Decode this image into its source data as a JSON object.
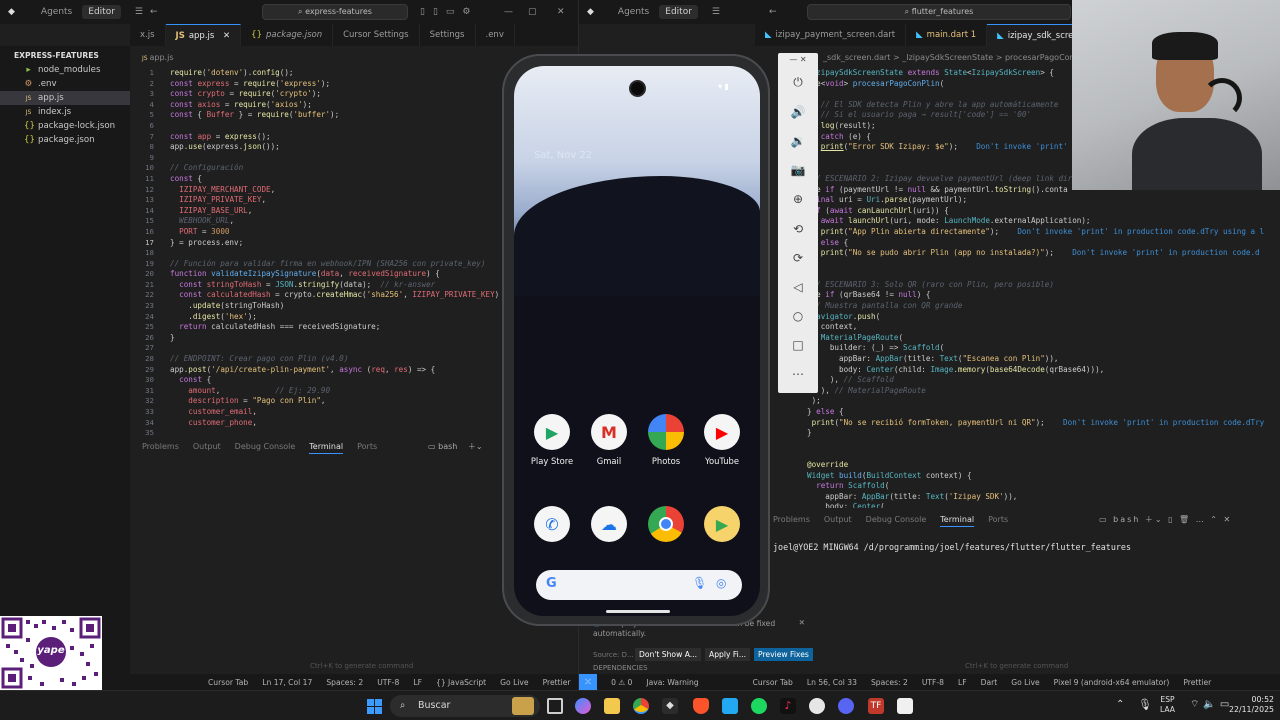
{
  "left_window": {
    "seg_agents": "Agents",
    "seg_editor": "Editor",
    "search": "express-features",
    "tabs": [
      {
        "label": "x.js",
        "active": false
      },
      {
        "label": "app.js",
        "active": true
      },
      {
        "label": "package.json",
        "active": false
      },
      {
        "label": "Cursor Settings",
        "active": false
      },
      {
        "label": "Settings",
        "active": false
      },
      {
        "label": ".env",
        "active": false
      }
    ],
    "breadcrumb": "app.js",
    "explorer_title": "EXPRESS-FEATURES",
    "explorer_items": [
      "node_modules",
      ".env",
      "app.js",
      "index.js",
      "package-lock.json",
      "package.json"
    ],
    "line_numbers": [
      "1",
      "2",
      "3",
      "4",
      "5",
      "6",
      "7",
      "8",
      "9",
      "10",
      "11",
      "12",
      "13",
      "14",
      "15",
      "16",
      "17",
      "18",
      "19",
      "20",
      "21",
      "22",
      "23",
      "24",
      "25",
      "26",
      "27",
      "28",
      "29",
      "30",
      "31",
      "32",
      "33",
      "34",
      "35"
    ],
    "panel_tabs": [
      "Problems",
      "Output",
      "Debug Console",
      "Terminal",
      "Ports"
    ],
    "panel_shell": "bash",
    "hint": "Ctrl+K to generate command",
    "status": [
      "Cursor Tab",
      "Ln 17, Col 17",
      "Spaces: 2",
      "UTF-8",
      "LF",
      "{} JavaScript",
      "Go Live",
      "Prettier"
    ]
  },
  "right_window": {
    "seg_agents": "Agents",
    "seg_editor": "Editor",
    "search": "flutter_features",
    "tabs": [
      {
        "label": "izipay_payment_screen.dart",
        "active": false
      },
      {
        "label": "main.dart 1",
        "active": false
      },
      {
        "label": "izipay_sdk_screen",
        "active": true
      }
    ],
    "breadcrumb": "_sdk_screen.dart  >  _IzipaySdkScreenState  >  procesarPagoConPlin",
    "panel_tabs": [
      "Problems",
      "Output",
      "Debug Console",
      "Terminal",
      "Ports"
    ],
    "panel_shell": "bash",
    "terminal_line": "joel@YOE2 MINGW64 /d/programming/joel/features/flutter/flutter_features",
    "notice": "Your project contains issues that can be fixed automatically.",
    "notice_source": "Source: D...",
    "notice_btns": [
      "Don't Show A...",
      "Apply Fi...",
      "Preview Fixes"
    ],
    "dependencies": "DEPENDENCIES",
    "hint": "Ctrl+K to generate command",
    "status": [
      "0 ⚠ 0",
      "Java: Warning",
      "Cursor Tab",
      "Ln 56, Col 33",
      "Spaces: 2",
      "UTF-8",
      "LF",
      "Dart",
      "Go Live",
      "Pixel 9 (android-x64 emulator)",
      "Prettier"
    ]
  },
  "phone": {
    "date": "Sat, Nov 22",
    "apps_row1": [
      "Play Store",
      "Gmail",
      "Photos",
      "YouTube"
    ]
  },
  "taskbar": {
    "search": "Buscar",
    "lang": "ESP",
    "lang2": "LAA",
    "time": "00:52",
    "date": "22/11/2025"
  },
  "qr": {
    "brand": "yape"
  },
  "colors": {
    "accent": "#3794ff",
    "editor_bg": "#1f1f1f",
    "sidebar_bg": "#181818"
  }
}
